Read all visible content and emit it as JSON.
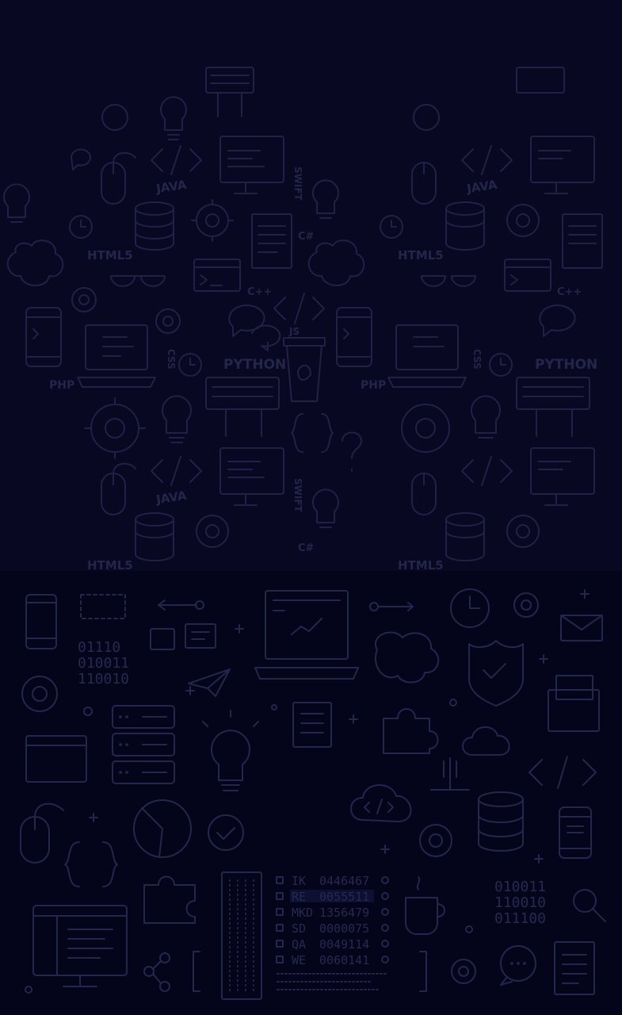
{
  "colors": {
    "background": "#05051a",
    "top_panel": "#080822",
    "bottom_panel": "#04041a",
    "line_art": "#1f2246"
  },
  "labels": {
    "java": "JAVA",
    "html5": "HTML5",
    "python": "PYTHON",
    "php": "PHP",
    "css": "CSS",
    "cpp": "C++",
    "csharp": "C#",
    "js": "JS",
    "swift": "SWIFT",
    "csharp_short": "C#"
  },
  "binary": {
    "block_a": [
      "01110",
      "010011",
      "110010"
    ],
    "block_b": [
      "010011",
      "110010",
      "011100"
    ]
  },
  "table": {
    "rows": [
      {
        "code": "IK",
        "value": "0446467"
      },
      {
        "code": "RE",
        "value": "0055511"
      },
      {
        "code": "MKD",
        "value": "1356479"
      },
      {
        "code": "SD",
        "value": "0000075"
      },
      {
        "code": "QA",
        "value": "0049114"
      },
      {
        "code": "WE",
        "value": "0060141"
      }
    ]
  },
  "icons": [
    "lightbulb-icon",
    "keyboard-icon",
    "monitor-icon",
    "mouse-icon",
    "database-icon",
    "gear-icon",
    "brain-icon",
    "glasses-icon",
    "phone-icon",
    "laptop-icon",
    "coffee-cup-icon",
    "code-brackets-icon",
    "chat-icon",
    "clock-icon",
    "shield-icon",
    "envelope-icon",
    "paper-plane-icon",
    "puzzle-icon",
    "cloud-icon",
    "server-icon",
    "pie-chart-icon",
    "magnifier-icon",
    "folder-icon",
    "document-icon",
    "share-icon"
  ]
}
